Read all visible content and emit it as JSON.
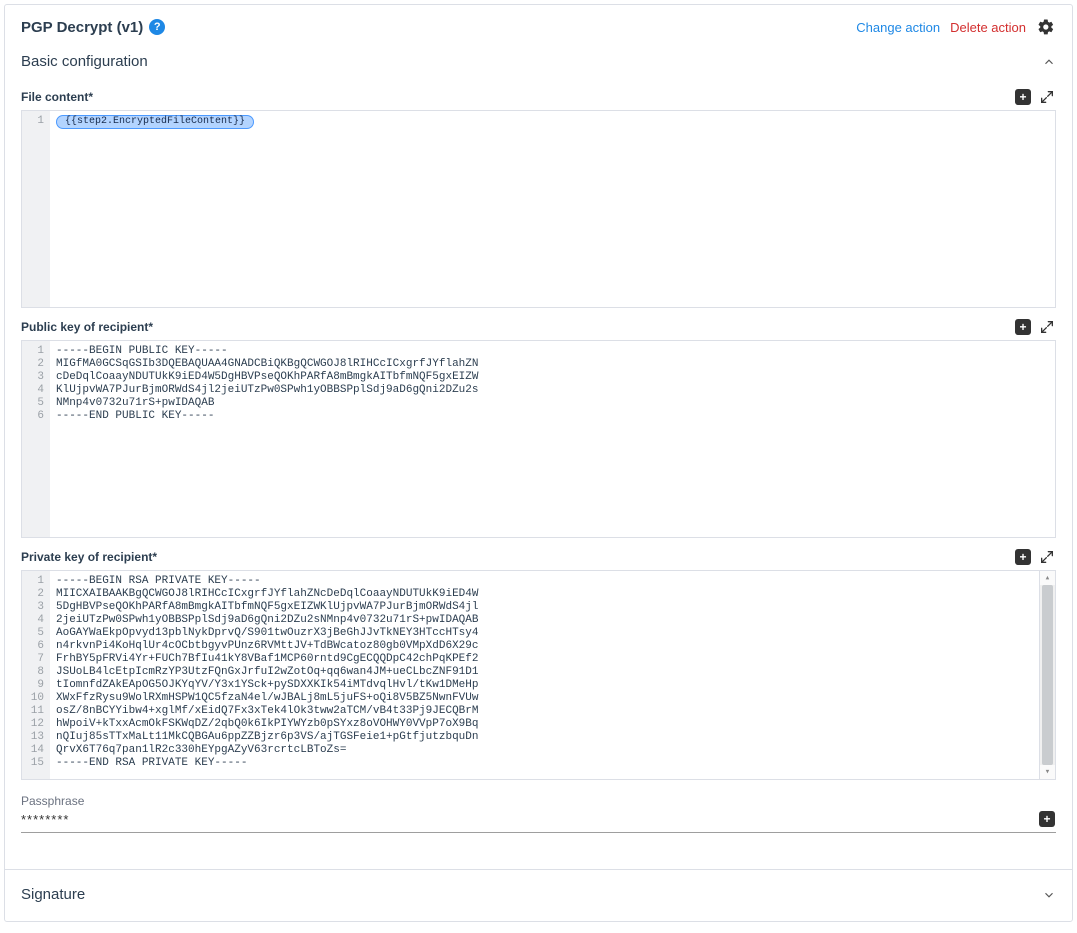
{
  "header": {
    "title": "PGP Decrypt (v1)",
    "change_action": "Change action",
    "delete_action": "Delete action"
  },
  "sections": {
    "basic_config_label": "Basic configuration",
    "signature_label": "Signature"
  },
  "fields": {
    "file_content": {
      "label": "File content*",
      "chip": "{{step2.EncryptedFileContent}}",
      "line_count": 1
    },
    "public_key": {
      "label": "Public key of recipient*",
      "lines": [
        "-----BEGIN PUBLIC KEY-----",
        "MIGfMA0GCSqGSIb3DQEBAQUAA4GNADCBiQKBgQCWGOJ8lRIHCcICxgrfJYflahZN",
        "cDeDqlCoaayNDUTUkK9iED4W5DgHBVPseQOKhPARfA8mBmgkAITbfmNQF5gxEIZW",
        "KlUjpvWA7PJurBjmORWdS4jl2jeiUTzPw0SPwh1yOBBSPplSdj9aD6gQni2DZu2s",
        "NMnp4v0732u71rS+pwIDAQAB",
        "-----END PUBLIC KEY-----"
      ]
    },
    "private_key": {
      "label": "Private key of recipient*",
      "lines": [
        "-----BEGIN RSA PRIVATE KEY-----",
        "MIICXAIBAAKBgQCWGOJ8lRIHCcICxgrfJYflahZNcDeDqlCoaayNDUTUkK9iED4W",
        "5DgHBVPseQOKhPARfA8mBmgkAITbfmNQF5gxEIZWKlUjpvWA7PJurBjmORWdS4jl",
        "2jeiUTzPw0SPwh1yOBBSPplSdj9aD6gQni2DZu2sNMnp4v0732u71rS+pwIDAQAB",
        "AoGAYWaEkpOpvyd13pblNykDprvQ/S901twOuzrX3jBeGhJJvTkNEY3HTccHTsy4",
        "n4rkvnPi4KoHqlUr4cOCbtbgyvPUnz6RVMttJV+TdBWcatoz80gb0VMpXdD6X29c",
        "FrhBY5pFRVi4Yr+FUCh7BfIu41kY8VBaf1MCP60rntd9CgECQQDpC42chPqKPEf2",
        "JSUoLB4lcEtpIcmRzYP3UtzFQnGxJrfuI2wZotOq+qq6wan4JM+ueCLbcZNF91D1",
        "tIomnfdZAkEApOG5OJKYqYV/Y3x1YSck+pySDXXKIk54iMTdvqlHvl/tKw1DMeHp",
        "XWxFfzRysu9WolRXmHSPW1QC5fzaN4el/wJBALj8mL5juFS+oQi8V5BZ5NwnFVUw",
        "osZ/8nBCYYibw4+xglMf/xEidQ7Fx3xTek4lOk3tww2aTCM/vB4t33Pj9JECQBrM",
        "hWpoiV+kTxxAcmOkFSKWqDZ/2qbQ0k6IkPIYWYzb0pSYxz8oVOHWY0VVpP7oX9Bq",
        "nQIuj85sTTxMaLt11MkCQBGAu6ppZZBjzr6p3VS/ajTGSFeie1+pGtfjutzbquDn",
        "QrvX6T76q7pan1lR2c330hEYpgAZyV63rcrtcLBToZs=",
        "-----END RSA PRIVATE KEY-----"
      ]
    },
    "passphrase": {
      "label": "Passphrase",
      "value": "********"
    }
  }
}
